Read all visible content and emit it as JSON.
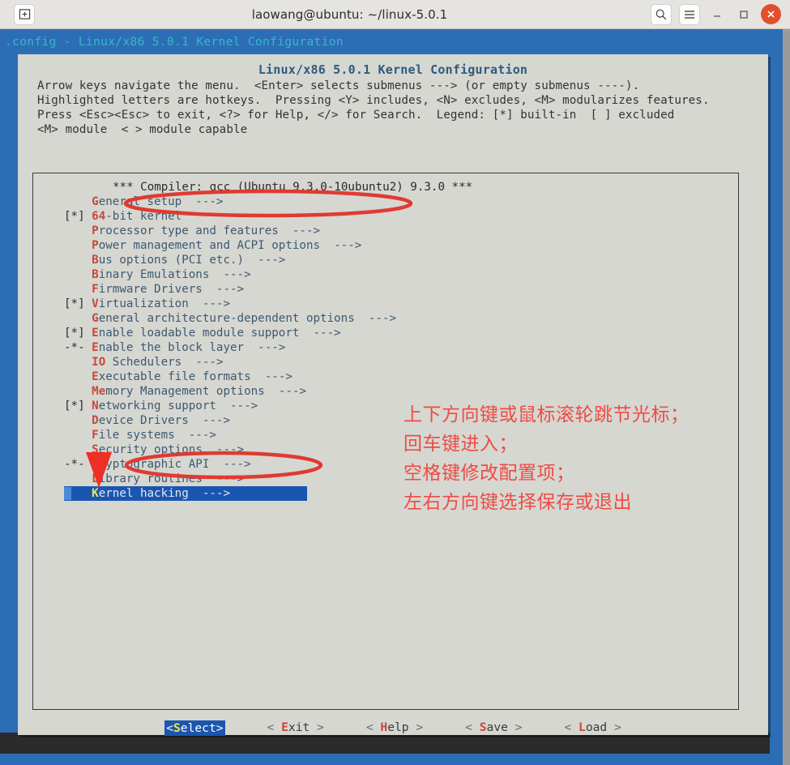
{
  "window": {
    "title": "laowang@ubuntu: ~/linux-5.0.1",
    "new_tab_icon": "new-tab-icon",
    "search_icon": "search-icon",
    "menu_icon": "hamburger-menu-icon",
    "minimize_icon": "minimize-icon",
    "maximize_icon": "maximize-icon",
    "close_icon": "close-icon",
    "close_color": "#e0502a"
  },
  "terminal": {
    "status_line": ".config - Linux/x86 5.0.1 Kernel Configuration",
    "status_color": "#36b7c4",
    "background_color": "#2c6eb5"
  },
  "dialog": {
    "title": "Linux/x86 5.0.1 Kernel Configuration",
    "title_color": "#2e5a80",
    "help_lines": [
      "Arrow keys navigate the menu.  <Enter> selects submenus ---> (or empty submenus ----).",
      "Highlighted letters are hotkeys.  Pressing <Y> includes, <N> excludes, <M> modularizes features.",
      "Press <Esc><Esc> to exit, <?> for Help, </> for Search.  Legend: [*] built-in  [ ] excluded",
      "<M> module  < > module capable"
    ],
    "panel_color": "#d6d7d1"
  },
  "menu": {
    "items": [
      {
        "mark": "",
        "hot": "",
        "label": "*** Compiler: gcc (Ubuntu 9.3.0-10ubuntu2) 9.3.0 ***",
        "arrow": "",
        "compiler": true,
        "selected": false
      },
      {
        "mark": "    ",
        "hot": "G",
        "label": "eneral setup",
        "arrow": "  --->",
        "compiler": false,
        "selected": false
      },
      {
        "mark": "[*] ",
        "hot": "64",
        "label": "-bit kernel",
        "arrow": "",
        "compiler": false,
        "selected": false
      },
      {
        "mark": "    ",
        "hot": "P",
        "label": "rocessor type and features",
        "arrow": "  --->",
        "compiler": false,
        "selected": false
      },
      {
        "mark": "    ",
        "hot": "P",
        "label": "ower management and ACPI options",
        "arrow": "  --->",
        "compiler": false,
        "selected": false
      },
      {
        "mark": "    ",
        "hot": "B",
        "label": "us options (PCI etc.)",
        "arrow": "  --->",
        "compiler": false,
        "selected": false
      },
      {
        "mark": "    ",
        "hot": "B",
        "label": "inary Emulations",
        "arrow": "  --->",
        "compiler": false,
        "selected": false
      },
      {
        "mark": "    ",
        "hot": "F",
        "label": "irmware Drivers",
        "arrow": "  --->",
        "compiler": false,
        "selected": false
      },
      {
        "mark": "[*] ",
        "hot": "V",
        "label": "irtualization",
        "arrow": "  --->",
        "compiler": false,
        "selected": false
      },
      {
        "mark": "    ",
        "hot": "G",
        "label": "eneral architecture-dependent options",
        "arrow": "  --->",
        "compiler": false,
        "selected": false
      },
      {
        "mark": "[*] ",
        "hot": "E",
        "label": "nable loadable module support",
        "arrow": "  --->",
        "compiler": false,
        "selected": false
      },
      {
        "mark": "-*- ",
        "hot": "E",
        "label": "nable the block layer",
        "arrow": "  --->",
        "compiler": false,
        "selected": false
      },
      {
        "mark": "    ",
        "hot": "IO",
        "label": " Schedulers",
        "arrow": "  --->",
        "compiler": false,
        "selected": false
      },
      {
        "mark": "    ",
        "hot": "E",
        "label": "xecutable file formats",
        "arrow": "  --->",
        "compiler": false,
        "selected": false
      },
      {
        "mark": "    ",
        "hot": "Me",
        "label": "mory Management options",
        "arrow": "  --->",
        "compiler": false,
        "selected": false
      },
      {
        "mark": "[*] ",
        "hot": "N",
        "label": "etworking support",
        "arrow": "  --->",
        "compiler": false,
        "selected": false
      },
      {
        "mark": "    ",
        "hot": "D",
        "label": "evice Drivers",
        "arrow": "  --->",
        "compiler": false,
        "selected": false
      },
      {
        "mark": "    ",
        "hot": "F",
        "label": "ile systems",
        "arrow": "  --->",
        "compiler": false,
        "selected": false
      },
      {
        "mark": "    ",
        "hot": "S",
        "label": "ecurity options",
        "arrow": "  --->",
        "compiler": false,
        "selected": false
      },
      {
        "mark": "-*- ",
        "hot": "C",
        "label": "ryptographic API",
        "arrow": "  --->",
        "compiler": false,
        "selected": false
      },
      {
        "mark": "    ",
        "hot": "L",
        "label": "ibrary routines",
        "arrow": "  --->",
        "compiler": false,
        "selected": false
      },
      {
        "mark": "    ",
        "hot": "K",
        "label": "ernel hacking",
        "arrow": "  --->",
        "compiler": false,
        "selected": true
      }
    ],
    "selected_index": 21,
    "selected_label": "Kernel hacking",
    "highlight_color": "#1a56b0",
    "hotkey_color": "#c9473b",
    "label_color": "#3d5872"
  },
  "buttons": [
    {
      "left": "<",
      "hot": "S",
      "rest": "elect",
      "right": ">",
      "selected": true
    },
    {
      "left": "< ",
      "hot": "E",
      "rest": "xit",
      "right": " >",
      "selected": false
    },
    {
      "left": "< ",
      "hot": "H",
      "rest": "elp",
      "right": " >",
      "selected": false
    },
    {
      "left": "< ",
      "hot": "S",
      "rest": "ave",
      "right": " >",
      "selected": false
    },
    {
      "left": "< ",
      "hot": "L",
      "rest": "oad",
      "right": " >",
      "selected": false
    }
  ],
  "annotations": {
    "color": "#ef4b44",
    "lines": [
      "上下方向键或鼠标滚轮跳节光标；",
      "回车键进入；",
      "空格键修改配置项；",
      "左右方向键选择保存或退出"
    ],
    "arrow": "down-arrow-annotation",
    "ellipses": [
      "ellipse-processor-type-and-features",
      "ellipse-kernel-hacking"
    ]
  }
}
